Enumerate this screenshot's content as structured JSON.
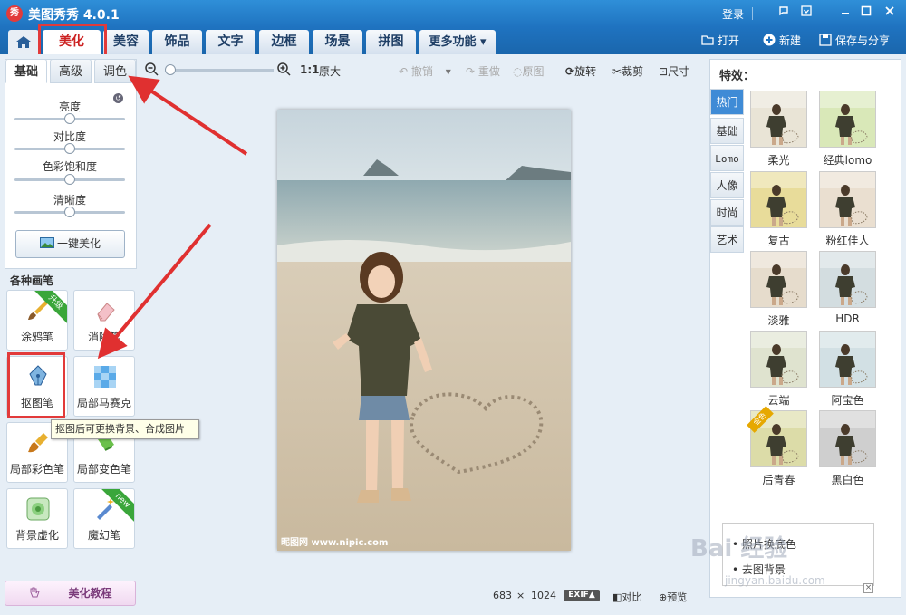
{
  "app": {
    "logo_text": "秀",
    "title": "美图秀秀 4.0.1",
    "login": "登录"
  },
  "menu_tabs": [
    "美化",
    "美容",
    "饰品",
    "文字",
    "边框",
    "场景",
    "拼图",
    "更多功能"
  ],
  "more_arrow": "▾",
  "header_actions": {
    "open": "打开",
    "new": "新建",
    "save_share": "保存与分享"
  },
  "left_tabs": [
    "基础",
    "高级",
    "调色"
  ],
  "sliders": [
    {
      "label": "亮度",
      "value": 0.5
    },
    {
      "label": "对比度",
      "value": 0.5
    },
    {
      "label": "色彩饱和度",
      "value": 0.5
    },
    {
      "label": "清晰度",
      "value": 0.5
    }
  ],
  "one_key_button": "一键美化",
  "brushes_title": "各种画笔",
  "brushes": [
    {
      "label": "涂鸦笔",
      "badge": "升级"
    },
    {
      "label": "消除笔",
      "badge": ""
    },
    {
      "label": "抠图笔",
      "badge": ""
    },
    {
      "label": "局部马赛克",
      "badge": ""
    },
    {
      "label": "局部彩色笔",
      "badge": ""
    },
    {
      "label": "局部变色笔",
      "badge": ""
    },
    {
      "label": "背景虚化",
      "badge": ""
    },
    {
      "label": "魔幻笔",
      "badge": "new"
    }
  ],
  "tooltip": "抠图后可更换背景、合成图片",
  "tutorial_button": "美化教程",
  "toolbar": {
    "zoom_ratio": "1:1",
    "original_size": "原大",
    "undo": "撤销",
    "redo": "重做",
    "original": "原图",
    "rotate": "旋转",
    "crop": "裁剪",
    "resize": "尺寸",
    "zoom_level": 0.05
  },
  "photo": {
    "watermark": "昵图网 www.nipic.com"
  },
  "effects_title": "特效：",
  "effect_categories": [
    "热门",
    "基础",
    "Lomo",
    "人像",
    "时尚",
    "艺术"
  ],
  "effects": [
    {
      "label": "柔光",
      "tint": "#e9e4d6"
    },
    {
      "label": "经典lomo",
      "tint": "#d9e8b8",
      "gold": false
    },
    {
      "label": "复古",
      "tint": "#e8dc9a"
    },
    {
      "label": "粉红佳人",
      "tint": "#eadfd0"
    },
    {
      "label": "淡雅",
      "tint": "#e6dccc"
    },
    {
      "label": "HDR",
      "tint": "#d3dde0"
    },
    {
      "label": "云端",
      "tint": "#dfe3cf"
    },
    {
      "label": "阿宝色",
      "tint": "#d2e0e4"
    },
    {
      "label": "后青春",
      "tint": "#dcdca8",
      "gold": true,
      "gold_text": "金色"
    },
    {
      "label": "黑白色",
      "tint": "#cfcfcf"
    }
  ],
  "tips": [
    "照片换底色",
    "去图背景"
  ],
  "status": {
    "width": "683",
    "times": "×",
    "height": "1024",
    "exif": "EXIF▲",
    "compare": "对比",
    "preview": "预览"
  },
  "watermark": {
    "brand": "Bai 经验",
    "url": "jingyan.baidu.com"
  },
  "colors": {
    "title_bar": "#1f73c0",
    "highlight": "#e23a3a",
    "active_category": "#3f8bd6"
  }
}
